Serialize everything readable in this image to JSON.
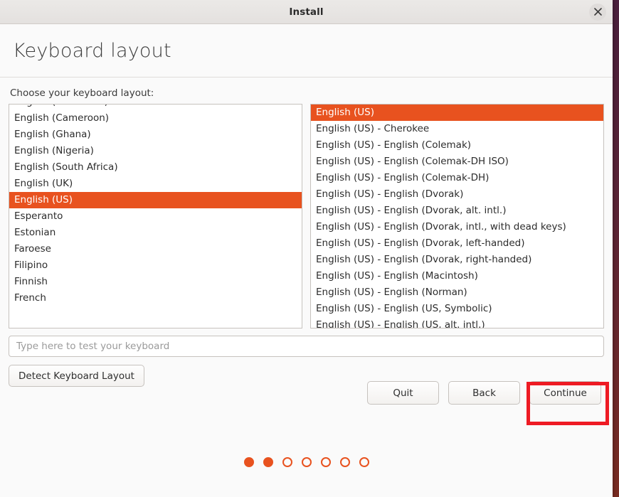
{
  "window": {
    "title": "Install",
    "close_icon": "close-icon"
  },
  "header": {
    "heading": "Keyboard layout"
  },
  "content": {
    "choose_label": "Choose your keyboard layout:"
  },
  "keyboard_layout_list": {
    "selected": "English (US)",
    "items": [
      {
        "label": "English (Australian)",
        "selected": false
      },
      {
        "label": "English (Cameroon)",
        "selected": false
      },
      {
        "label": "English (Ghana)",
        "selected": false
      },
      {
        "label": "English (Nigeria)",
        "selected": false
      },
      {
        "label": "English (South Africa)",
        "selected": false
      },
      {
        "label": "English (UK)",
        "selected": false
      },
      {
        "label": "English (US)",
        "selected": true
      },
      {
        "label": "Esperanto",
        "selected": false
      },
      {
        "label": "Estonian",
        "selected": false
      },
      {
        "label": "Faroese",
        "selected": false
      },
      {
        "label": "Filipino",
        "selected": false
      },
      {
        "label": "Finnish",
        "selected": false
      },
      {
        "label": "French",
        "selected": false
      }
    ]
  },
  "keyboard_variant_list": {
    "selected": "English (US)",
    "items": [
      {
        "label": "English (US)",
        "selected": true
      },
      {
        "label": "English (US) - Cherokee",
        "selected": false
      },
      {
        "label": "English (US) - English (Colemak)",
        "selected": false
      },
      {
        "label": "English (US) - English (Colemak-DH ISO)",
        "selected": false
      },
      {
        "label": "English (US) - English (Colemak-DH)",
        "selected": false
      },
      {
        "label": "English (US) - English (Dvorak)",
        "selected": false
      },
      {
        "label": "English (US) - English (Dvorak, alt. intl.)",
        "selected": false
      },
      {
        "label": "English (US) - English (Dvorak, intl., with dead keys)",
        "selected": false
      },
      {
        "label": "English (US) - English (Dvorak, left-handed)",
        "selected": false
      },
      {
        "label": "English (US) - English (Dvorak, right-handed)",
        "selected": false
      },
      {
        "label": "English (US) - English (Macintosh)",
        "selected": false
      },
      {
        "label": "English (US) - English (Norman)",
        "selected": false
      },
      {
        "label": "English (US) - English (US, Symbolic)",
        "selected": false
      },
      {
        "label": "English (US) - English (US, alt. intl.)",
        "selected": false
      }
    ]
  },
  "keyboard_test": {
    "value": "",
    "placeholder": "Type here to test your keyboard"
  },
  "detect_button": {
    "label": "Detect Keyboard Layout"
  },
  "actions": {
    "quit_label": "Quit",
    "back_label": "Back",
    "continue_label": "Continue"
  },
  "progress": {
    "total": 7,
    "completed": 2,
    "dots": [
      {
        "filled": true
      },
      {
        "filled": true
      },
      {
        "filled": false
      },
      {
        "filled": false
      },
      {
        "filled": false
      },
      {
        "filled": false
      },
      {
        "filled": false
      }
    ]
  },
  "colors": {
    "accent": "#e8521f",
    "highlight": "#ee1b24",
    "window_bg": "#fafafa"
  }
}
